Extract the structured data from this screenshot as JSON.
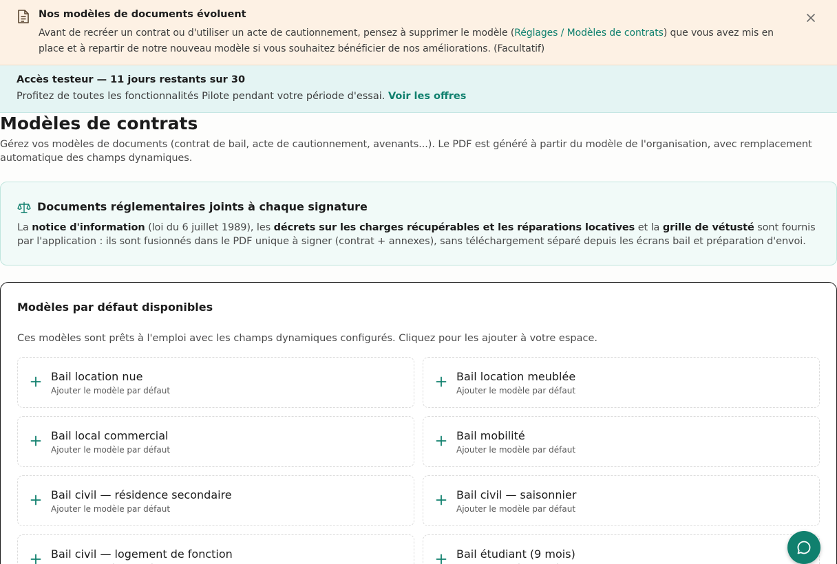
{
  "notice": {
    "title": "Nos modèles de documents évoluent",
    "text_before": "Avant de recréer un contrat ou d'utiliser un acte de cautionnement, pensez à supprimer le modèle (",
    "link": "Réglages / Modèles de contrats",
    "text_after": ") que vous avez mis en place et à repartir de notre nouveau modèle si vous souhaitez bénéficier de nos améliorations. (Facultatif)"
  },
  "trial": {
    "title": "Accès testeur — 11 jours restants sur 30",
    "text": "Profitez de toutes les fonctionnalités Pilote pendant votre période d'essai. ",
    "link": "Voir les offres"
  },
  "page": {
    "title": "Modèles de contrats",
    "subtitle": "Gérez vos modèles de documents (contrat de bail, acte de cautionnement, avenants...). Le PDF est généré à partir du modèle de l'organisation, avec remplacement automatique des champs dynamiques."
  },
  "regulatory": {
    "title": "Documents réglementaires joints à chaque signature",
    "p1": "La ",
    "b1": "notice d'information",
    "p2": " (loi du 6 juillet 1989), les ",
    "b2": "décrets sur les charges récupérables et les réparations locatives",
    "p3": " et la ",
    "b3": "grille de vétusté",
    "p4": " sont fournis par l'application : ils sont fusionnés dans le PDF unique à signer (contrat + annexes), sans téléchargement séparé depuis les écrans bail et préparation d'envoi."
  },
  "defaults": {
    "title": "Modèles par défaut disponibles",
    "description": "Ces modèles sont prêts à l'emploi avec les champs dynamiques configurés. Cliquez pour les ajouter à votre espace.",
    "add_label": "Ajouter le modèle par défaut",
    "templates": [
      "Bail location nue",
      "Bail location meublée",
      "Bail local commercial",
      "Bail mobilité",
      "Bail civil — résidence secondaire",
      "Bail civil — saisonnier",
      "Bail civil — logement de fonction",
      "Bail étudiant (9 mois)"
    ]
  },
  "colors": {
    "accent": "#10806e",
    "notice_bg": "#fdf1e4",
    "trial_bg": "#e4f4f3",
    "regulatory_bg": "#f1faf8"
  },
  "icons": {
    "notice": "document-icon",
    "close": "close-icon",
    "regulatory": "scale-icon",
    "add": "plus-icon",
    "chat": "chat-bubble-icon"
  }
}
